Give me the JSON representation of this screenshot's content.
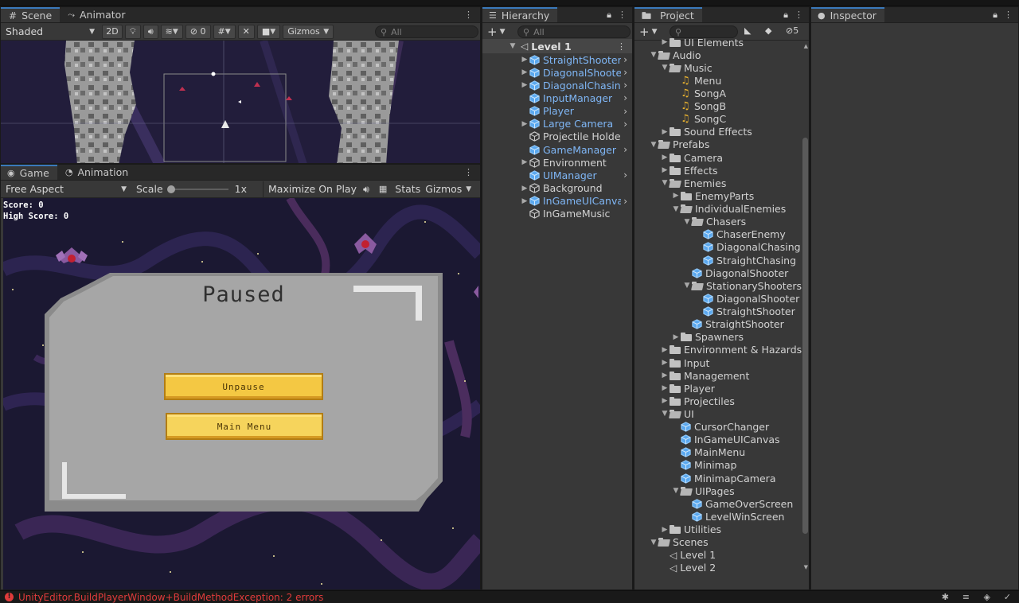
{
  "scene_panel": {
    "tabs": [
      {
        "label": "Scene",
        "icon": "grid-icon"
      },
      {
        "label": "Animator",
        "icon": "animator-icon"
      }
    ],
    "shading_mode": "Shaded",
    "toggle_2d": "2D",
    "hidden_count": "0",
    "gizmos_label": "Gizmos",
    "search_placeholder": "All"
  },
  "game_panel": {
    "tabs": [
      {
        "label": "Game",
        "icon": "gamepad-icon"
      },
      {
        "label": "Animation",
        "icon": "clock-icon"
      }
    ],
    "aspect": "Free Aspect",
    "scale_label": "Scale",
    "scale_value": "1x",
    "maximize_label": "Maximize On Play",
    "stats_label": "Stats",
    "gizmos_label": "Gizmos",
    "hud": {
      "score": "Score: 0",
      "high_score": "High Score: 0"
    },
    "pause_menu": {
      "title": "Paused",
      "unpause": "Unpause",
      "main_menu": "Main Menu"
    }
  },
  "hierarchy": {
    "tab_label": "Hierarchy",
    "search_placeholder": "All",
    "scene_name": "Level 1",
    "items": [
      {
        "label": "StraightShooter",
        "prefab": true,
        "expandable": true,
        "chevron": true
      },
      {
        "label": "DiagonalShooter",
        "prefab": true,
        "expandable": true,
        "chevron": true
      },
      {
        "label": "DiagonalChasing",
        "prefab": true,
        "expandable": true,
        "chevron": true
      },
      {
        "label": "InputManager",
        "prefab": true,
        "expandable": false,
        "chevron": true
      },
      {
        "label": "Player",
        "prefab": true,
        "expandable": false,
        "chevron": true
      },
      {
        "label": "Large Camera",
        "prefab": true,
        "expandable": true,
        "chevron": true
      },
      {
        "label": "Projectile Holder",
        "prefab": false,
        "expandable": false,
        "chevron": false
      },
      {
        "label": "GameManager",
        "prefab": true,
        "expandable": false,
        "chevron": true
      },
      {
        "label": "Environment",
        "prefab": false,
        "expandable": true,
        "chevron": false
      },
      {
        "label": "UIManager",
        "prefab": true,
        "expandable": false,
        "chevron": true
      },
      {
        "label": "Background",
        "prefab": false,
        "expandable": true,
        "chevron": false
      },
      {
        "label": "InGameUICanvas",
        "prefab": true,
        "expandable": true,
        "chevron": true
      },
      {
        "label": "InGameMusic",
        "prefab": false,
        "expandable": false,
        "chevron": false
      }
    ]
  },
  "project": {
    "tab_label": "Project",
    "hidden_count": "5",
    "tree": [
      {
        "label": "UI Elements",
        "depth": 1,
        "type": "folder",
        "arrow": "closed"
      },
      {
        "label": "Audio",
        "depth": 0,
        "type": "folder-open",
        "arrow": "open"
      },
      {
        "label": "Music",
        "depth": 1,
        "type": "folder-open",
        "arrow": "open"
      },
      {
        "label": "Menu",
        "depth": 2,
        "type": "audio",
        "arrow": "none"
      },
      {
        "label": "SongA",
        "depth": 2,
        "type": "audio",
        "arrow": "none"
      },
      {
        "label": "SongB",
        "depth": 2,
        "type": "audio",
        "arrow": "none"
      },
      {
        "label": "SongC",
        "depth": 2,
        "type": "audio",
        "arrow": "none"
      },
      {
        "label": "Sound Effects",
        "depth": 1,
        "type": "folder",
        "arrow": "closed"
      },
      {
        "label": "Prefabs",
        "depth": 0,
        "type": "folder-open",
        "arrow": "open"
      },
      {
        "label": "Camera",
        "depth": 1,
        "type": "folder",
        "arrow": "closed"
      },
      {
        "label": "Effects",
        "depth": 1,
        "type": "folder",
        "arrow": "closed"
      },
      {
        "label": "Enemies",
        "depth": 1,
        "type": "folder-open",
        "arrow": "open"
      },
      {
        "label": "EnemyParts",
        "depth": 2,
        "type": "folder",
        "arrow": "closed"
      },
      {
        "label": "IndividualEnemies",
        "depth": 2,
        "type": "folder-open",
        "arrow": "open"
      },
      {
        "label": "Chasers",
        "depth": 3,
        "type": "folder-open",
        "arrow": "open"
      },
      {
        "label": "ChaserEnemy",
        "depth": 4,
        "type": "prefab",
        "arrow": "none"
      },
      {
        "label": "DiagonalChasing",
        "depth": 4,
        "type": "prefab",
        "arrow": "none"
      },
      {
        "label": "StraightChasing",
        "depth": 4,
        "type": "prefab",
        "arrow": "none"
      },
      {
        "label": "DiagonalShooter",
        "depth": 3,
        "type": "prefab",
        "arrow": "none"
      },
      {
        "label": "StationaryShooters",
        "depth": 3,
        "type": "folder-open",
        "arrow": "open"
      },
      {
        "label": "DiagonalShooter",
        "depth": 4,
        "type": "prefab",
        "arrow": "none"
      },
      {
        "label": "StraightShooter",
        "depth": 4,
        "type": "prefab",
        "arrow": "none"
      },
      {
        "label": "StraightShooter",
        "depth": 3,
        "type": "prefab",
        "arrow": "none"
      },
      {
        "label": "Spawners",
        "depth": 2,
        "type": "folder",
        "arrow": "closed"
      },
      {
        "label": "Environment & Hazards",
        "depth": 1,
        "type": "folder",
        "arrow": "closed"
      },
      {
        "label": "Input",
        "depth": 1,
        "type": "folder",
        "arrow": "closed"
      },
      {
        "label": "Management",
        "depth": 1,
        "type": "folder",
        "arrow": "closed"
      },
      {
        "label": "Player",
        "depth": 1,
        "type": "folder",
        "arrow": "closed"
      },
      {
        "label": "Projectiles",
        "depth": 1,
        "type": "folder",
        "arrow": "closed"
      },
      {
        "label": "UI",
        "depth": 1,
        "type": "folder-open",
        "arrow": "open"
      },
      {
        "label": "CursorChanger",
        "depth": 2,
        "type": "prefab",
        "arrow": "none"
      },
      {
        "label": "InGameUICanvas",
        "depth": 2,
        "type": "prefab",
        "arrow": "none"
      },
      {
        "label": "MainMenu",
        "depth": 2,
        "type": "prefab",
        "arrow": "none"
      },
      {
        "label": "Minimap",
        "depth": 2,
        "type": "prefab",
        "arrow": "none"
      },
      {
        "label": "MinimapCamera",
        "depth": 2,
        "type": "prefab",
        "arrow": "none"
      },
      {
        "label": "UIPages",
        "depth": 2,
        "type": "folder-open",
        "arrow": "open"
      },
      {
        "label": "GameOverScreen",
        "depth": 3,
        "type": "prefab",
        "arrow": "none"
      },
      {
        "label": "LevelWinScreen",
        "depth": 3,
        "type": "prefab",
        "arrow": "none"
      },
      {
        "label": "Utilities",
        "depth": 1,
        "type": "folder",
        "arrow": "closed"
      },
      {
        "label": "Scenes",
        "depth": 0,
        "type": "folder-open",
        "arrow": "open"
      },
      {
        "label": "Level 1",
        "depth": 1,
        "type": "scene",
        "arrow": "none"
      },
      {
        "label": "Level 2",
        "depth": 1,
        "type": "scene",
        "arrow": "none"
      }
    ]
  },
  "inspector": {
    "tab_label": "Inspector"
  },
  "status_bar": {
    "message": "UnityEditor.BuildPlayerWindow+BuildMethodException: 2 errors"
  },
  "colors": {
    "accent": "#3a79bb",
    "prefab_blue": "#7fb6f5",
    "error_red": "#e03b3b",
    "button_gold": "#f4c843"
  }
}
